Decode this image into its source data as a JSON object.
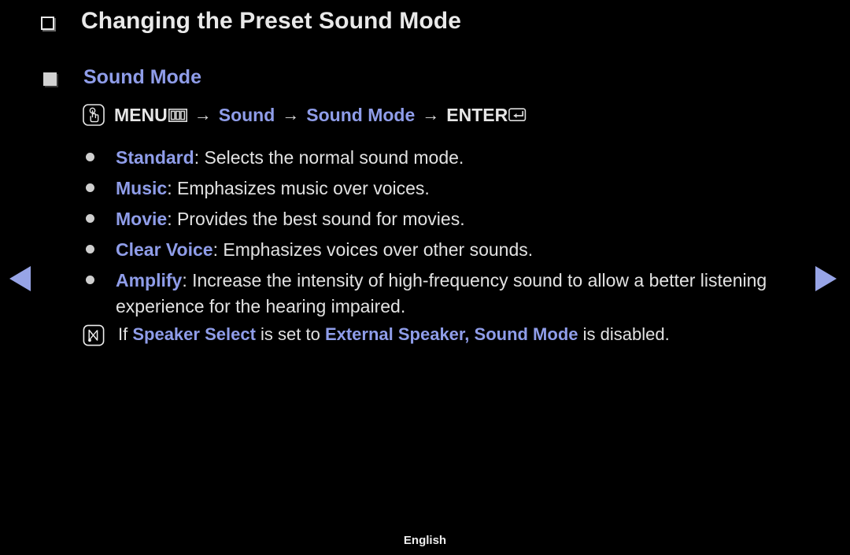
{
  "page": {
    "title": "Changing the Preset Sound Mode",
    "title_bullet_icon": "hollow-square-icon",
    "background_color": "#000000",
    "accent_color": "#8f9de9",
    "text_color": "#e2e2e2"
  },
  "section": {
    "heading": "Sound Mode",
    "heading_bullet_icon": "filled-square-icon",
    "path": {
      "osd_icon": "osd-hand-press-icon",
      "menu_label": "MENU",
      "menu_icon": "menu-bars-icon",
      "arrow": "→",
      "step_sound": "Sound",
      "step_sound_mode": "Sound Mode",
      "enter_label": "ENTER",
      "enter_icon": "enter-return-icon"
    }
  },
  "options": [
    {
      "name": "Standard",
      "desc": ": Selects the normal sound mode."
    },
    {
      "name": "Music",
      "desc": ": Emphasizes music over voices."
    },
    {
      "name": "Movie",
      "desc": ": Provides the best sound for movies."
    },
    {
      "name": "Clear Voice",
      "desc": ": Emphasizes voices over other sounds."
    },
    {
      "name": "Amplify",
      "desc": ": Increase the intensity of high-frequency sound to allow a better listening experience for the hearing impaired."
    }
  ],
  "note": {
    "icon": "note-n-icon",
    "part1": "If ",
    "term1": "Speaker Select",
    "part2": " is set to ",
    "term2": "External Speaker",
    "part3": ", ",
    "term3": "Sound Mode",
    "part4": " is disabled."
  },
  "nav": {
    "prev_icon": "triangle-left-icon",
    "next_icon": "triangle-right-icon",
    "arrow_color": "#97a4e6"
  },
  "footer": {
    "language": "English"
  }
}
